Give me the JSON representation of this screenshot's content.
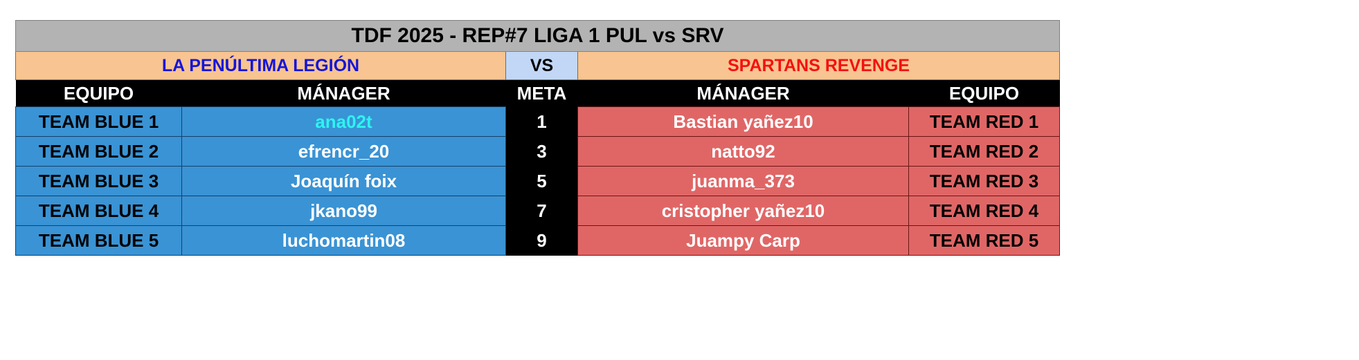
{
  "title": "TDF 2025 - REP#7 LIGA 1 PUL vs SRV",
  "matchup": {
    "left_team": "LA PENÚLTIMA LEGIÓN",
    "vs_label": "VS",
    "right_team": "SPARTANS REVENGE",
    "left_team_color": "#1515d8",
    "right_team_color": "#f4120e",
    "vs_background": "#c2d7f5",
    "row_background": "#f8c491"
  },
  "headers": {
    "equipo_left": "EQUIPO",
    "manager_left": "MÁNAGER",
    "meta": "META",
    "manager_right": "MÁNAGER",
    "equipo_right": "EQUIPO"
  },
  "colors": {
    "title_background": "#b3b3b3",
    "header_background": "#000000",
    "blue_side": "#3a93d4",
    "red_side": "#e06666",
    "highlight_manager": "#2ff2f2"
  },
  "rows": [
    {
      "team_left": "TEAM BLUE 1",
      "manager_left": "ana02t",
      "manager_left_highlight": true,
      "meta": "1",
      "manager_right": "Bastian yañez10",
      "team_right": "TEAM RED 1"
    },
    {
      "team_left": "TEAM BLUE 2",
      "manager_left": "efrencr_20",
      "manager_left_highlight": false,
      "meta": "3",
      "manager_right": "natto92",
      "team_right": "TEAM RED 2"
    },
    {
      "team_left": "TEAM BLUE 3",
      "manager_left": "Joaquín foix",
      "manager_left_highlight": false,
      "meta": "5",
      "manager_right": "juanma_373",
      "team_right": "TEAM RED 3"
    },
    {
      "team_left": "TEAM BLUE 4",
      "manager_left": "jkano99",
      "manager_left_highlight": false,
      "meta": "7",
      "manager_right": "cristopher yañez10",
      "team_right": "TEAM RED 4"
    },
    {
      "team_left": "TEAM BLUE 5",
      "manager_left": "luchomartin08",
      "manager_left_highlight": false,
      "meta": "9",
      "manager_right": "Juampy Carp",
      "team_right": "TEAM RED 5"
    }
  ]
}
